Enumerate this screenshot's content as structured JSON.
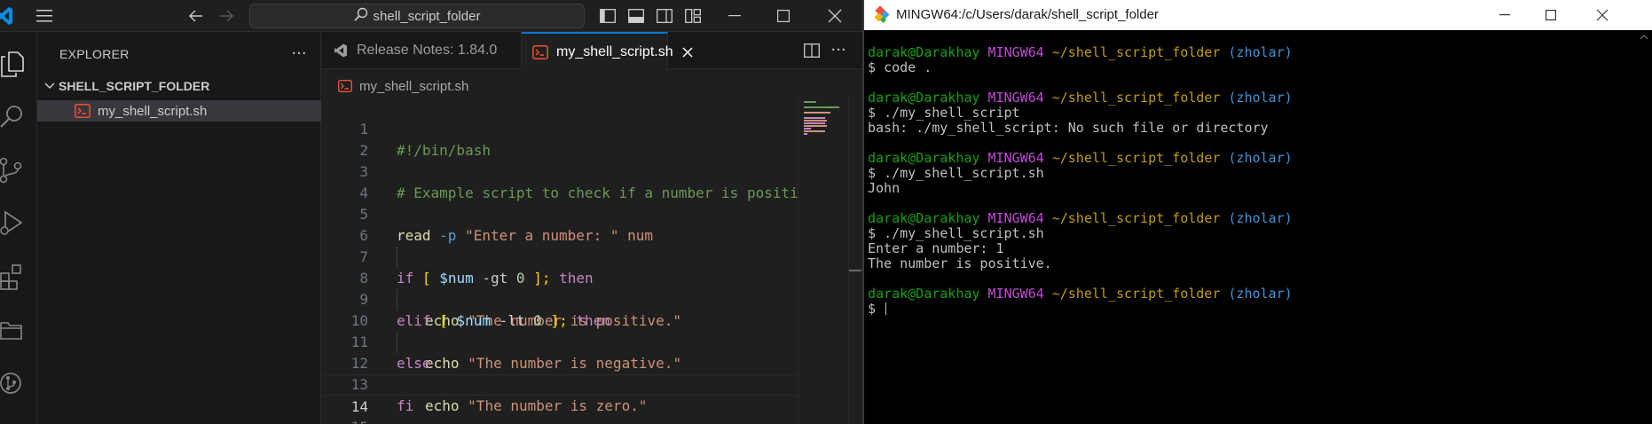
{
  "vscode": {
    "search": {
      "text": "shell_script_folder"
    },
    "explorer": {
      "title": "EXPLORER",
      "folder": "SHELL_SCRIPT_FOLDER",
      "files": [
        "my_shell_script.sh"
      ]
    },
    "tabs": [
      {
        "label": "Release Notes: 1.84.0",
        "icon": "vscode-icon",
        "active": false
      },
      {
        "label": "my_shell_script.sh",
        "icon": "shell-file-icon",
        "active": true
      }
    ],
    "breadcrumb": "my_shell_script.sh",
    "editor": {
      "active_line": "14",
      "line_numbers": [
        "1",
        "2",
        "3",
        "4",
        "5",
        "6",
        "7",
        "8",
        "9",
        "10",
        "11",
        "12",
        "13",
        "14",
        "15"
      ],
      "lines": {
        "l1": {
          "shebang": "#!/bin/bash"
        },
        "l3": {
          "comment": "# Example script to check if a number is positi"
        },
        "l5": {
          "read": "read",
          "flag": "-p",
          "prompt": "\"Enter a number: \"",
          "var": "num"
        },
        "l7": {
          "if": "if",
          "open": "[",
          "var": "$num",
          "op": "-gt",
          "num": "0",
          "close": "];",
          "then": "then"
        },
        "l8": {
          "echo": "echo",
          "str": "\"The number is positive.\""
        },
        "l9": {
          "elif": "elif",
          "open": "[",
          "var": "$num",
          "op": "-lt",
          "num": "0",
          "close": "];",
          "then": "then"
        },
        "l10": {
          "echo": "echo",
          "str": "\"The number is negative.\""
        },
        "l11": {
          "else": "else"
        },
        "l12": {
          "echo": "echo",
          "str": "\"The number is zero.\""
        },
        "l13": {
          "fi": "fi"
        }
      }
    },
    "colors": {
      "accent": "#0078d4",
      "background": "#1f1f1f",
      "sidebar": "#181818"
    }
  },
  "terminal": {
    "title": "MINGW64:/c/Users/darak/shell_script_folder",
    "prompt": {
      "user": "darak@Darakhay",
      "host": "MINGW64",
      "path": "~/shell_script_folder",
      "branch": "(zholar)",
      "symbol": "$"
    },
    "sessions": [
      {
        "command": "code .",
        "output": []
      },
      {
        "command": "./my_shell_script",
        "output": [
          "bash: ./my_shell_script: No such file or directory"
        ]
      },
      {
        "command": "./my_shell_script.sh",
        "output": [
          "John"
        ]
      },
      {
        "command": "./my_shell_script.sh",
        "output": [
          "Enter a number: 1",
          "The number is positive."
        ]
      }
    ],
    "colors": {
      "user": "#13a10e",
      "host": "#c14ad6",
      "path": "#c19c00",
      "branch": "#3a96dd"
    }
  }
}
